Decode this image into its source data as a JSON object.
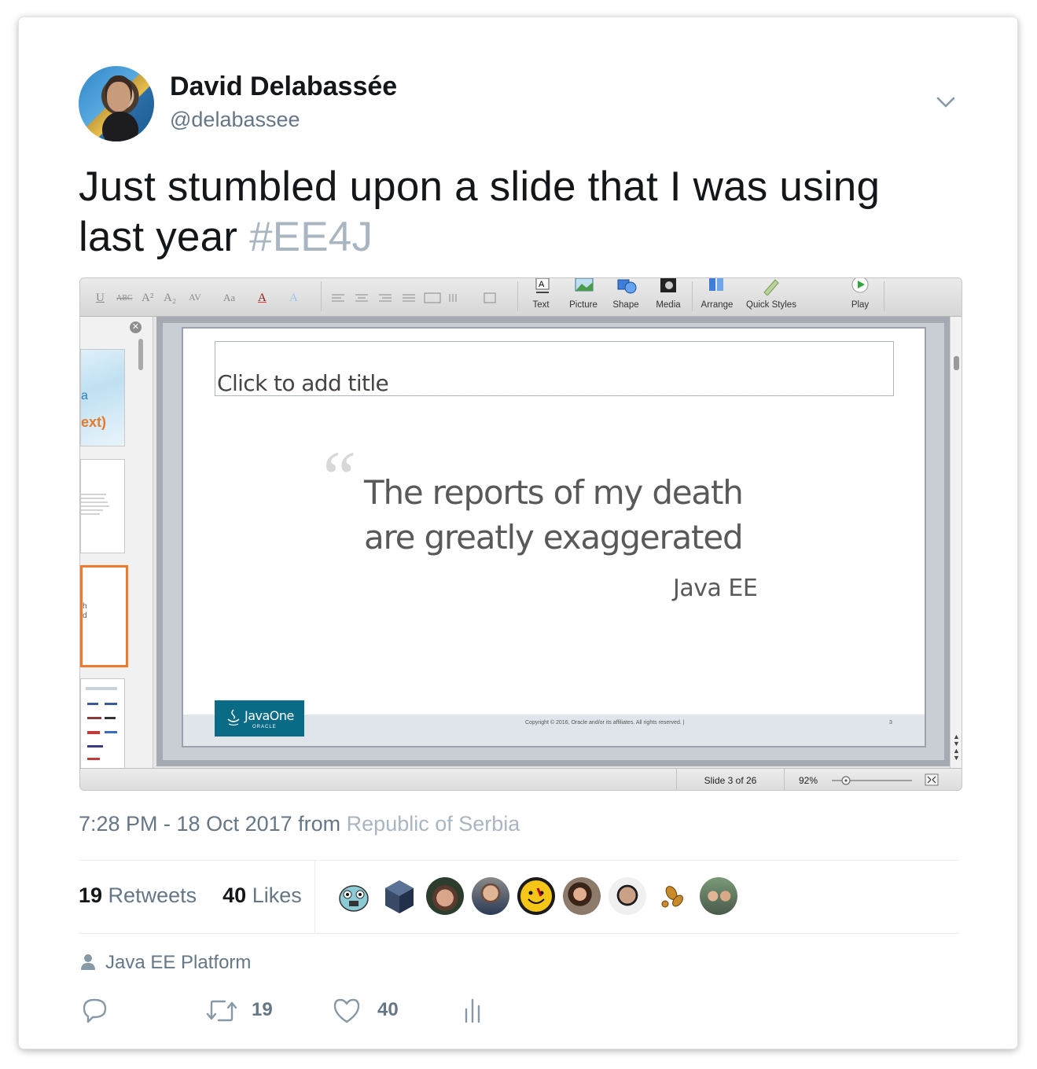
{
  "user": {
    "name": "David Delabassée",
    "handle": "@delabassee"
  },
  "tweet": {
    "text": "Just stumbled upon a slide that I was using last year ",
    "hashtag": "#EE4J"
  },
  "screenshot": {
    "toolbar": {
      "format_labels": [
        "U",
        "ABC",
        "A²",
        "A₂",
        "AV",
        "Aa",
        "A",
        "A"
      ],
      "tools": [
        "Text",
        "Picture",
        "Shape",
        "Media",
        "Arrange",
        "Quick Styles",
        "Play"
      ]
    },
    "slide": {
      "title_placeholder": "Click to add title",
      "quote_line1": "The reports of my death",
      "quote_line2": "are  greatly exaggerated",
      "author": "Java EE",
      "logo_main": "JavaOne",
      "logo_sub": "ORACLE",
      "copyright": "Copyright © 2016, Oracle and/or its affiliates. All rights reserved.  |",
      "page_number": "3"
    },
    "thumbnail_text": {
      "t1": "a",
      "t2": "ext)",
      "t3": "h",
      "t4": "d"
    },
    "status": {
      "slide_indicator": "Slide 3 of 26",
      "zoom": "92%"
    }
  },
  "meta": {
    "time": "7:28 PM - 18 Oct 2017",
    "from": " from ",
    "location": "Republic of Serbia"
  },
  "stats": {
    "retweets_count": "19",
    "retweets_label": " Retweets",
    "likes_count": "40",
    "likes_label": " Likes"
  },
  "context": {
    "label": "Java EE Platform"
  },
  "actions": {
    "retweet_count": "19",
    "like_count": "40"
  },
  "colors": {
    "text": "#14171a",
    "muted": "#657786",
    "hashtag": "#a9b6c1",
    "divider": "#e6ecf0"
  }
}
